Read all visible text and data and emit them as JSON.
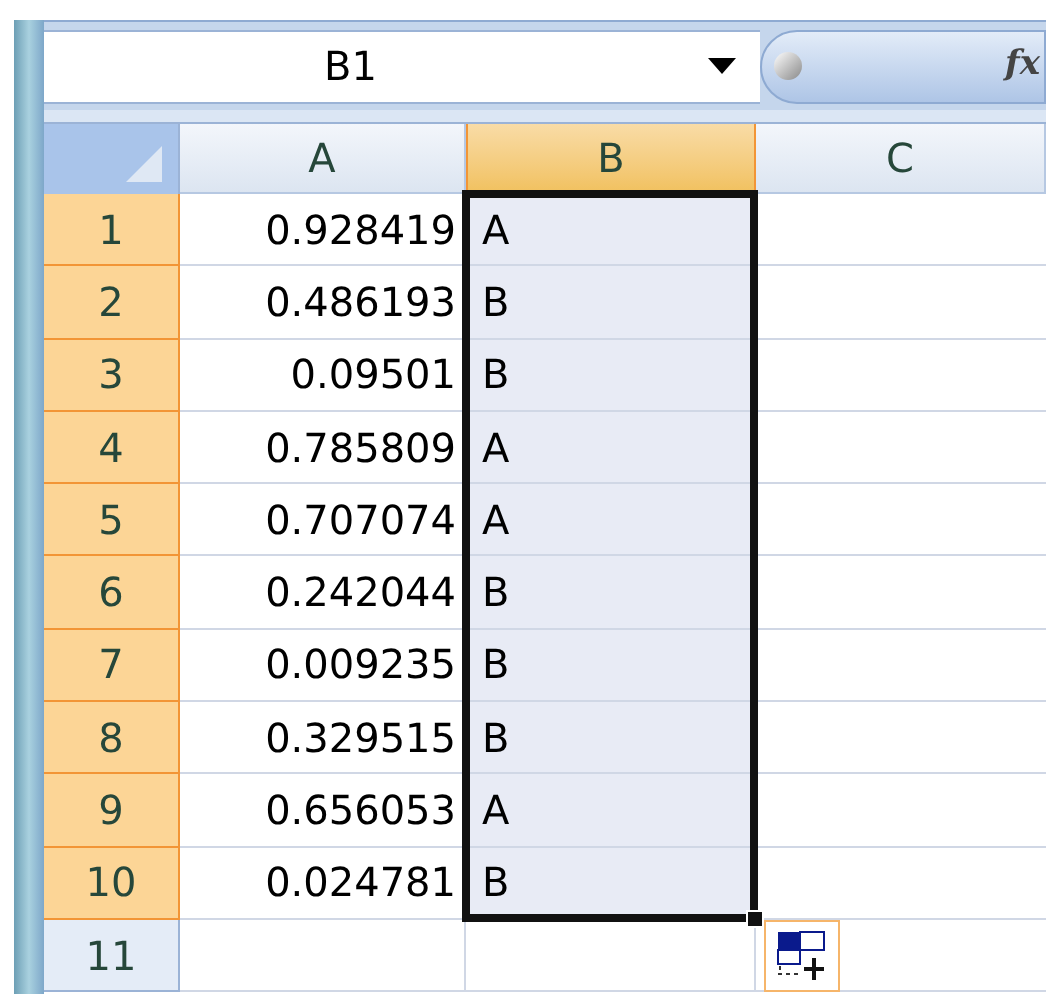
{
  "name_box": {
    "value": "B1"
  },
  "formula_bar": {
    "function_label": "fx"
  },
  "columns": [
    {
      "label": "A",
      "selected": false
    },
    {
      "label": "B",
      "selected": true
    },
    {
      "label": "C",
      "selected": false
    }
  ],
  "rows": [
    {
      "header": "1",
      "selected": true,
      "a": "0.928419",
      "b": "A"
    },
    {
      "header": "2",
      "selected": true,
      "a": "0.486193",
      "b": "B"
    },
    {
      "header": "3",
      "selected": true,
      "a": "0.09501",
      "b": "B"
    },
    {
      "header": "4",
      "selected": true,
      "a": "0.785809",
      "b": "A"
    },
    {
      "header": "5",
      "selected": true,
      "a": "0.707074",
      "b": "A"
    },
    {
      "header": "6",
      "selected": true,
      "a": "0.242044",
      "b": "B"
    },
    {
      "header": "7",
      "selected": true,
      "a": "0.009235",
      "b": "B"
    },
    {
      "header": "8",
      "selected": true,
      "a": "0.329515",
      "b": "B"
    },
    {
      "header": "9",
      "selected": true,
      "a": "0.656053",
      "b": "A"
    },
    {
      "header": "10",
      "selected": true,
      "a": "0.024781",
      "b": "B"
    },
    {
      "header": "11",
      "selected": false
    }
  ],
  "autofill_options": {
    "shown": true
  }
}
